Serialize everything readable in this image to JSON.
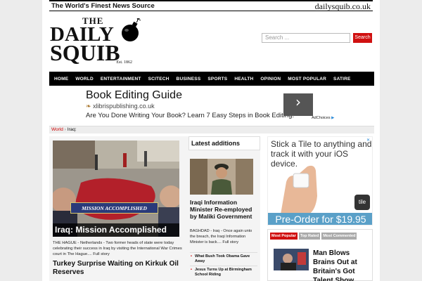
{
  "site": {
    "tagline": "The World's Finest News Source",
    "domain": "dailysquib.co.uk",
    "logo_the": "THE",
    "logo_daily": "DAILY",
    "logo_squib": "SQUIB",
    "logo_est": "Est. 1862"
  },
  "search": {
    "placeholder": "Search ...",
    "button_label": "Search"
  },
  "nav": {
    "items": [
      "HOME",
      "WORLD",
      "ENTERTAINMENT",
      "SCITECH",
      "BUSINESS",
      "SPORTS",
      "HEALTH",
      "OPINION",
      "MOST POPULAR",
      "SATIRE"
    ]
  },
  "ad": {
    "title": "Book Editing Guide",
    "url": "xlibrispublishing.co.uk",
    "description": "Are You Done Writing Your Book? Learn 7 Easy Steps in Book Editing.",
    "adchoices": "AdChoices"
  },
  "breadcrumb": {
    "section": "World",
    "separator": "›",
    "current": "Iraq:"
  },
  "main_story": {
    "caption": "Iraq: Mission Accomplished",
    "banner": "MISSION ACCOMPLISHED",
    "excerpt": "THE HAGUE - Netherlands - Two former heads of state were today celebrating their success in Iraq by visiting the International War Crimes court in The Hague.... Full story",
    "next_title": "Turkey Surprise Waiting on Kirkuk Oil Reserves"
  },
  "latest": {
    "heading": "Latest additions",
    "title": "Iraqi Information Minister Re-employed by Maliki Government",
    "excerpt": "BAGHDAD - Iraq - Once again unto the breach, the Iraqi Information Minister is back.... Full story",
    "list": [
      "What Bush Took Obama Gave Away",
      "Jesus Turns Up at Birmingham School Riding"
    ]
  },
  "tile_ad": {
    "text": "Stick a Tile to anything and track it with your iOS device.",
    "brand": "tile",
    "cta": "Pre-Order for $19.95"
  },
  "popular": {
    "tabs": [
      "Most Popular",
      "Top Rated",
      "Most Commented"
    ],
    "title": "Man Blows Brains Out at Britain's Got Talent Show"
  },
  "colors": {
    "accent": "#d01010",
    "nav_bg": "#000000",
    "tile_blue": "#5aa0c8"
  }
}
